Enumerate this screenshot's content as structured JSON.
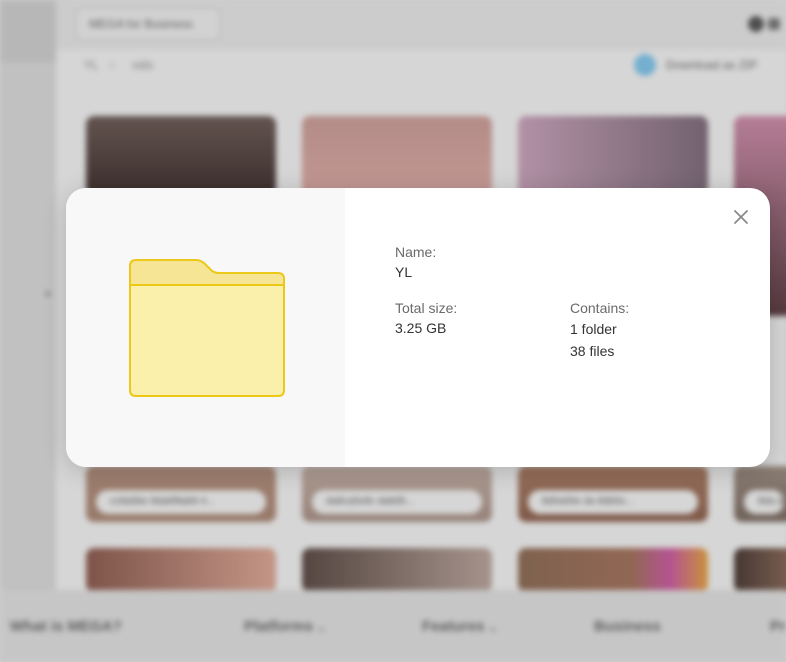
{
  "background": {
    "business_button": "MEGA for Business",
    "breadcrumb": [
      "YL",
      "vids"
    ],
    "download_label": "Download as ZIP",
    "tiles_top": [
      {
        "caption": ""
      },
      {
        "caption": ""
      },
      {
        "caption": ""
      },
      {
        "caption": ""
      }
    ],
    "tiles_mid": [
      {
        "caption": "cc8a5be 8da6f8ab9 4..."
      },
      {
        "caption": "da8ca5e8c da8d5..."
      },
      {
        "caption": "8d0a66e da 8db5e..."
      },
      {
        "caption": "8da ab8..."
      }
    ],
    "footer_nav": [
      {
        "label": "What is MEGA?",
        "has_chevron": false
      },
      {
        "label": "Platforms",
        "has_chevron": true
      },
      {
        "label": "Features",
        "has_chevron": true
      },
      {
        "label": "Business",
        "has_chevron": false
      },
      {
        "label": "Pr",
        "has_chevron": false
      }
    ]
  },
  "modal": {
    "name_label": "Name:",
    "name_value": "YL",
    "size_label": "Total size:",
    "size_value": "3.25 GB",
    "contains_label": "Contains:",
    "contains_folders": "1 folder",
    "contains_files": "38 files",
    "folder_icon": "folder-icon",
    "close_icon": "close-icon"
  },
  "colors": {
    "folder_fill": "#faf0ab",
    "folder_stroke": "#ecc818",
    "folder_tab": "#f5e594",
    "modal_bg": "#ffffff",
    "modal_left_bg": "#f8f8f8"
  }
}
